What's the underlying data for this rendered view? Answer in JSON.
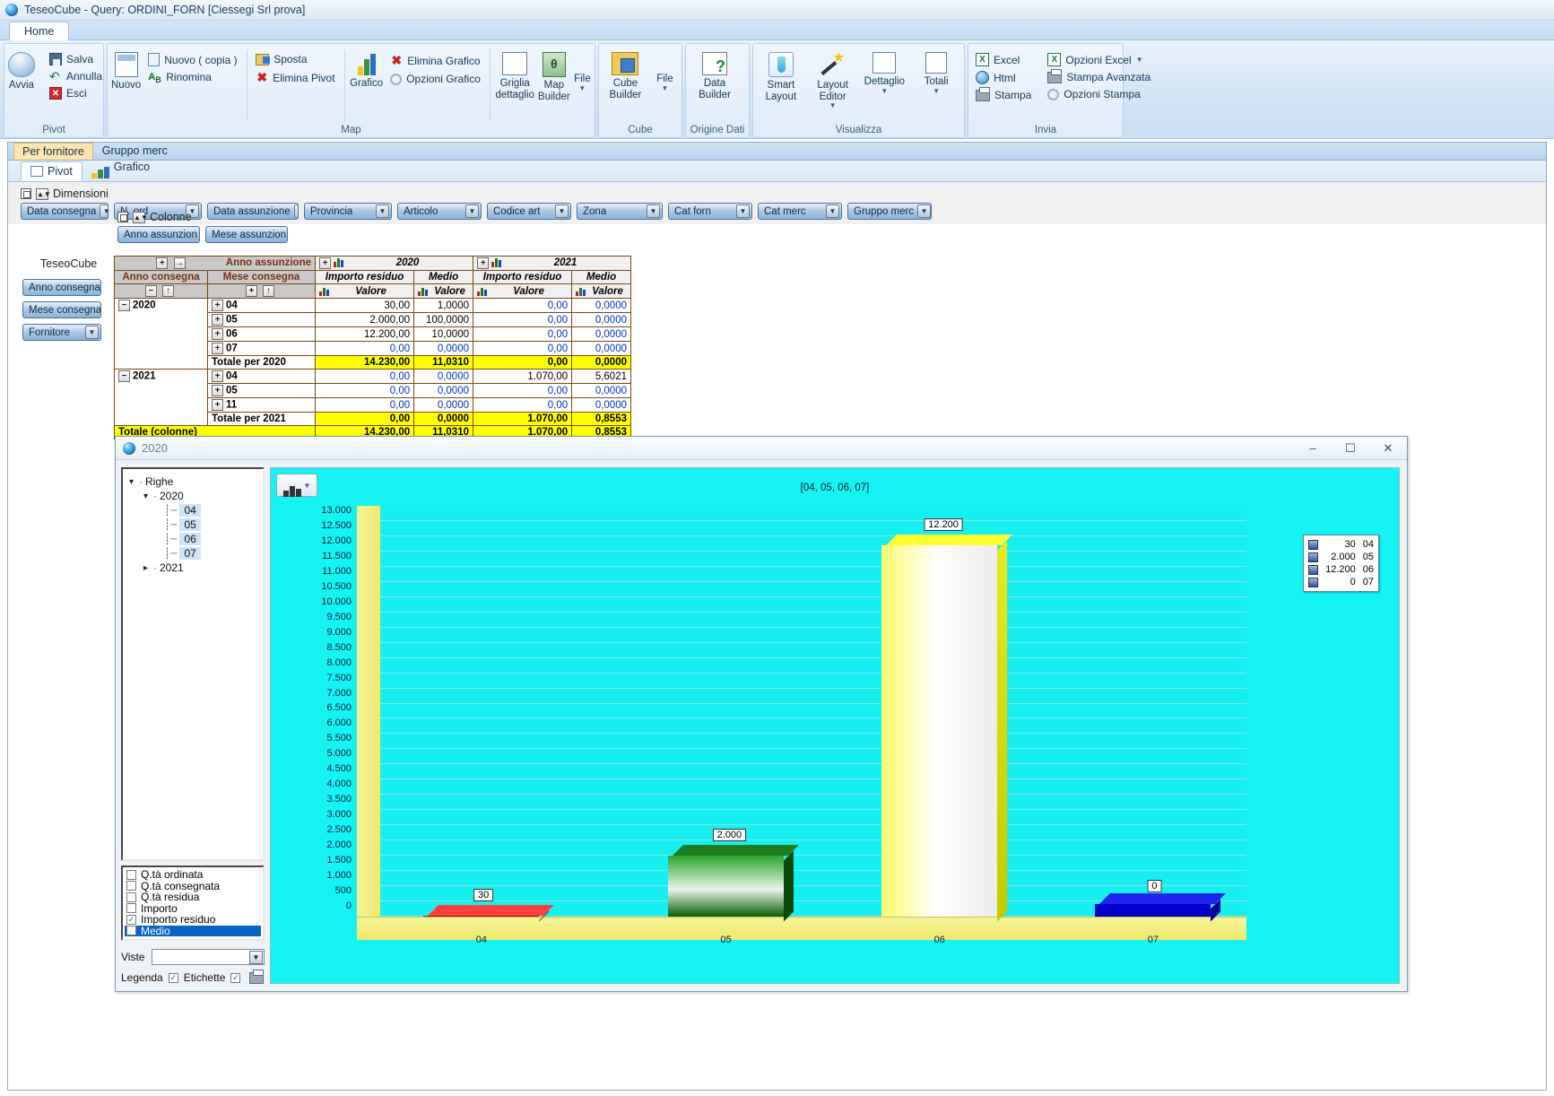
{
  "window": {
    "title": "TeseoCube - Query: ORDINI_FORN [Ciessegi Srl prova]",
    "app_icon": "globe-icon"
  },
  "ribbon": {
    "tabs": [
      "Home"
    ],
    "groups": [
      {
        "name": "Pivot",
        "title": "Pivot",
        "big": [
          {
            "label": "Avvia",
            "icon": "avvia-icon"
          }
        ],
        "small": [
          {
            "label": "Salva",
            "icon": "save-icon"
          },
          {
            "label": "Annulla",
            "icon": "undo-icon"
          },
          {
            "label": "Esci",
            "icon": "exit-icon"
          }
        ]
      },
      {
        "name": "Map",
        "title": "Map",
        "big": [
          {
            "label": "Nuovo",
            "icon": "new-pivot-icon"
          }
        ],
        "small": [
          {
            "label": "Nuovo ( copia )",
            "icon": "copy-icon"
          },
          {
            "label": "Rinomina",
            "icon": "rename-icon"
          },
          {
            "label": "Sposta",
            "icon": "move-icon"
          },
          {
            "label": "Elimina Pivot",
            "icon": "delete-icon"
          },
          {
            "label": "Elimina Grafico",
            "icon": "delete-icon"
          },
          {
            "label": "Opzioni Grafico",
            "icon": "gear-icon"
          }
        ],
        "big2": [
          {
            "label": "Grafico",
            "icon": "chart-icon"
          },
          {
            "label": "Griglia dettaglio",
            "icon": "grid-icon"
          },
          {
            "label": "Map Builder",
            "icon": "map-builder-icon"
          },
          {
            "label": "File",
            "icon": "file-dropdown-icon"
          }
        ]
      },
      {
        "name": "Cube",
        "title": "Cube",
        "big": [
          {
            "label": "Cube Builder",
            "icon": "cube-builder-icon"
          },
          {
            "label": "File",
            "icon": "file-dropdown-icon"
          }
        ]
      },
      {
        "name": "Origine Dati",
        "title": "Origine Dati",
        "big": [
          {
            "label": "Data Builder",
            "icon": "data-builder-icon"
          }
        ]
      },
      {
        "name": "Visualizza",
        "title": "Visualizza",
        "big": [
          {
            "label": "Smart Layout",
            "icon": "smart-layout-icon"
          },
          {
            "label": "Layout Editor",
            "icon": "layout-editor-icon"
          },
          {
            "label": "Dettaglio",
            "icon": "detail-icon"
          },
          {
            "label": "Totali",
            "icon": "totals-icon"
          }
        ]
      },
      {
        "name": "Invia",
        "title": "Invia",
        "small": [
          {
            "label": "Excel",
            "icon": "excel-icon"
          },
          {
            "label": "Html",
            "icon": "html-icon"
          },
          {
            "label": "Stampa",
            "icon": "print-icon"
          },
          {
            "label": "Opzioni Excel",
            "icon": "excel-icon"
          },
          {
            "label": "Stampa Avanzata",
            "icon": "print-icon"
          },
          {
            "label": "Opzioni Stampa",
            "icon": "gear-icon"
          }
        ]
      }
    ]
  },
  "doc_tabs": [
    {
      "label": "Per fornitore",
      "active": true
    },
    {
      "label": "Gruppo merc",
      "active": false
    }
  ],
  "view_tabs": [
    {
      "label": "Pivot",
      "icon": "pivot-icon",
      "active": true
    },
    {
      "label": "Grafico",
      "icon": "chart-icon",
      "active": false
    }
  ],
  "dimensions": {
    "label": "Dimensioni",
    "items": [
      "Data consegna",
      "N. ord",
      "Data assunzione",
      "Provincia",
      "Articolo",
      "Codice art",
      "Zona",
      "Cat forn",
      "Cat merc",
      "Gruppo merc"
    ]
  },
  "columns_zone": {
    "label": "Colonne",
    "items": [
      "Anno assunzion",
      "Mese assunzion"
    ]
  },
  "rows_zone": {
    "cube_label": "TeseoCube",
    "items": [
      "Anno consegna",
      "Mese consegna",
      "Fornitore"
    ]
  },
  "pivot": {
    "col_dimension_label": "Anno assunzione",
    "row_dim_labels": [
      "Anno consegna",
      "Mese consegna"
    ],
    "col_groups": [
      {
        "year": "2020",
        "measures": [
          "Importo residuo",
          "Medio"
        ],
        "sub": [
          "Valore",
          "Valore"
        ]
      },
      {
        "year": "2021",
        "measures": [
          "Importo residuo",
          "Medio"
        ],
        "sub": [
          "Valore",
          "Valore"
        ]
      }
    ],
    "rows": [
      {
        "year": "2020",
        "first": true,
        "month": "04",
        "cells": [
          {
            "v": "30,00",
            "zero": false
          },
          {
            "v": "1,0000",
            "zero": false
          },
          {
            "v": "0,00",
            "zero": true
          },
          {
            "v": "0,0000",
            "zero": true
          }
        ]
      },
      {
        "year": "",
        "first": false,
        "month": "05",
        "cells": [
          {
            "v": "2.000,00",
            "zero": false
          },
          {
            "v": "100,0000",
            "zero": false
          },
          {
            "v": "0,00",
            "zero": true
          },
          {
            "v": "0,0000",
            "zero": true
          }
        ]
      },
      {
        "year": "",
        "first": false,
        "month": "06",
        "cells": [
          {
            "v": "12.200,00",
            "zero": false
          },
          {
            "v": "10,0000",
            "zero": false
          },
          {
            "v": "0,00",
            "zero": true
          },
          {
            "v": "0,0000",
            "zero": true
          }
        ]
      },
      {
        "year": "",
        "first": false,
        "month": "07",
        "cells": [
          {
            "v": "0,00",
            "zero": true
          },
          {
            "v": "0,0000",
            "zero": true
          },
          {
            "v": "0,00",
            "zero": true
          },
          {
            "v": "0,0000",
            "zero": true
          }
        ]
      },
      {
        "year": "",
        "first": false,
        "month": "Totale per 2020",
        "total": true,
        "cells": [
          {
            "v": "14.230,00"
          },
          {
            "v": "11,0310"
          },
          {
            "v": "0,00"
          },
          {
            "v": "0,0000"
          }
        ]
      },
      {
        "year": "2021",
        "first": true,
        "month": "04",
        "cells": [
          {
            "v": "0,00",
            "zero": true
          },
          {
            "v": "0,0000",
            "zero": true
          },
          {
            "v": "1.070,00",
            "zero": false
          },
          {
            "v": "5,6021",
            "zero": false
          }
        ]
      },
      {
        "year": "",
        "first": false,
        "month": "05",
        "cells": [
          {
            "v": "0,00",
            "zero": true
          },
          {
            "v": "0,0000",
            "zero": true
          },
          {
            "v": "0,00",
            "zero": true
          },
          {
            "v": "0,0000",
            "zero": true
          }
        ]
      },
      {
        "year": "",
        "first": false,
        "month": "11",
        "cells": [
          {
            "v": "0,00",
            "zero": true
          },
          {
            "v": "0,0000",
            "zero": true
          },
          {
            "v": "0,00",
            "zero": true
          },
          {
            "v": "0,0000",
            "zero": true
          }
        ]
      },
      {
        "year": "",
        "first": false,
        "month": "Totale per 2021",
        "total": true,
        "cells": [
          {
            "v": "0,00"
          },
          {
            "v": "0,0000"
          },
          {
            "v": "1.070,00"
          },
          {
            "v": "0,8553"
          }
        ]
      }
    ],
    "grand_total": {
      "label": "Totale (colonne)",
      "cells": [
        "14.230,00",
        "11,0310",
        "1.070,00",
        "0,8553"
      ]
    }
  },
  "chart_window": {
    "title": "2020",
    "minimize": "–",
    "maximize": "☐",
    "close": "✕",
    "tree": {
      "root": "Righe",
      "nodes": [
        {
          "label": "2020",
          "expanded": true,
          "children": [
            "04",
            "05",
            "06",
            "07"
          ]
        },
        {
          "label": "2021",
          "expanded": false,
          "children": []
        }
      ]
    },
    "measures": [
      {
        "label": "Q.tà ordinata",
        "checked": false,
        "selected": false
      },
      {
        "label": "Q.tà consegnata",
        "checked": false,
        "selected": false
      },
      {
        "label": "Q.tà residua",
        "checked": false,
        "selected": false
      },
      {
        "label": "Importo",
        "checked": false,
        "selected": false
      },
      {
        "label": "Importo residuo",
        "checked": true,
        "selected": false
      },
      {
        "label": "Medio",
        "checked": false,
        "selected": true
      }
    ],
    "viste_label": "Viste",
    "viste_value": "",
    "legenda_label": "Legenda",
    "legenda_checked": true,
    "etichette_label": "Etichette",
    "etichette_checked": true,
    "print_icon": "print-icon"
  },
  "chart_data": {
    "type": "bar",
    "title": "[04, 05, 06, 07]",
    "categories": [
      "04",
      "05",
      "06",
      "07"
    ],
    "values": [
      30,
      2000,
      12200,
      0
    ],
    "data_labels": [
      "30",
      "2.000",
      "12.200",
      "0"
    ],
    "colors": [
      "#d90000",
      "#0a7a12",
      "#f2f200",
      "#0000cc"
    ],
    "xlabel": "",
    "ylabel": "",
    "ylim": [
      0,
      13500
    ],
    "ytick_step": 500,
    "yticks": [
      "13.000",
      "12.500",
      "12.000",
      "11.500",
      "11.000",
      "10.500",
      "10.000",
      "9.500",
      "9.000",
      "8.500",
      "8.000",
      "7.500",
      "7.000",
      "6.500",
      "6.000",
      "5.500",
      "5.000",
      "4.500",
      "4.000",
      "3.500",
      "3.000",
      "2.500",
      "2.000",
      "1.500",
      "1.000",
      "500",
      "0"
    ],
    "grid": true,
    "legend_position": "right",
    "legend": [
      {
        "value": "30",
        "category": "04"
      },
      {
        "value": "2.000",
        "category": "05"
      },
      {
        "value": "12.200",
        "category": "06"
      },
      {
        "value": "0",
        "category": "07"
      }
    ],
    "background": "#15f3f3",
    "plot_background": "#16efef"
  }
}
